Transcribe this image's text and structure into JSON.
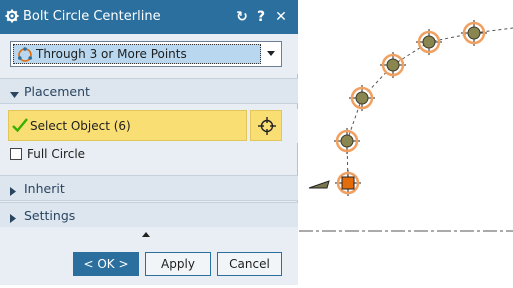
{
  "titlebar": {
    "title": "Bolt Circle Centerline",
    "reset_glyph": "↻",
    "help_glyph": "?",
    "close_glyph": "✕"
  },
  "type_select": {
    "value": "Through 3 or More Points"
  },
  "sections": {
    "placement": "Placement",
    "inherit": "Inherit",
    "settings": "Settings"
  },
  "placement": {
    "select_object_label": "Select Object (6)",
    "full_circle_label": "Full Circle",
    "full_circle_checked": false
  },
  "buttons": {
    "ok": "< OK >",
    "apply": "Apply",
    "cancel": "Cancel"
  },
  "icons": {
    "gear": "gear-icon",
    "reset": "reset-icon",
    "help": "help-icon",
    "close": "close-icon",
    "type_option": "circle-points-icon",
    "check": "checkmark-icon",
    "crosshair": "crosshair-icon",
    "expand": "triangle-right-icon",
    "collapse": "triangle-down-icon",
    "collapse_panel": "triangle-up-icon"
  },
  "colors": {
    "titlebar": "#2a6f9e",
    "selection_highlight": "#f9de74",
    "bolt_highlight": "#f0a060",
    "bolt_fill": "#8a8650",
    "selected_point": "#e46c0a",
    "checkmark": "#38b000"
  }
}
